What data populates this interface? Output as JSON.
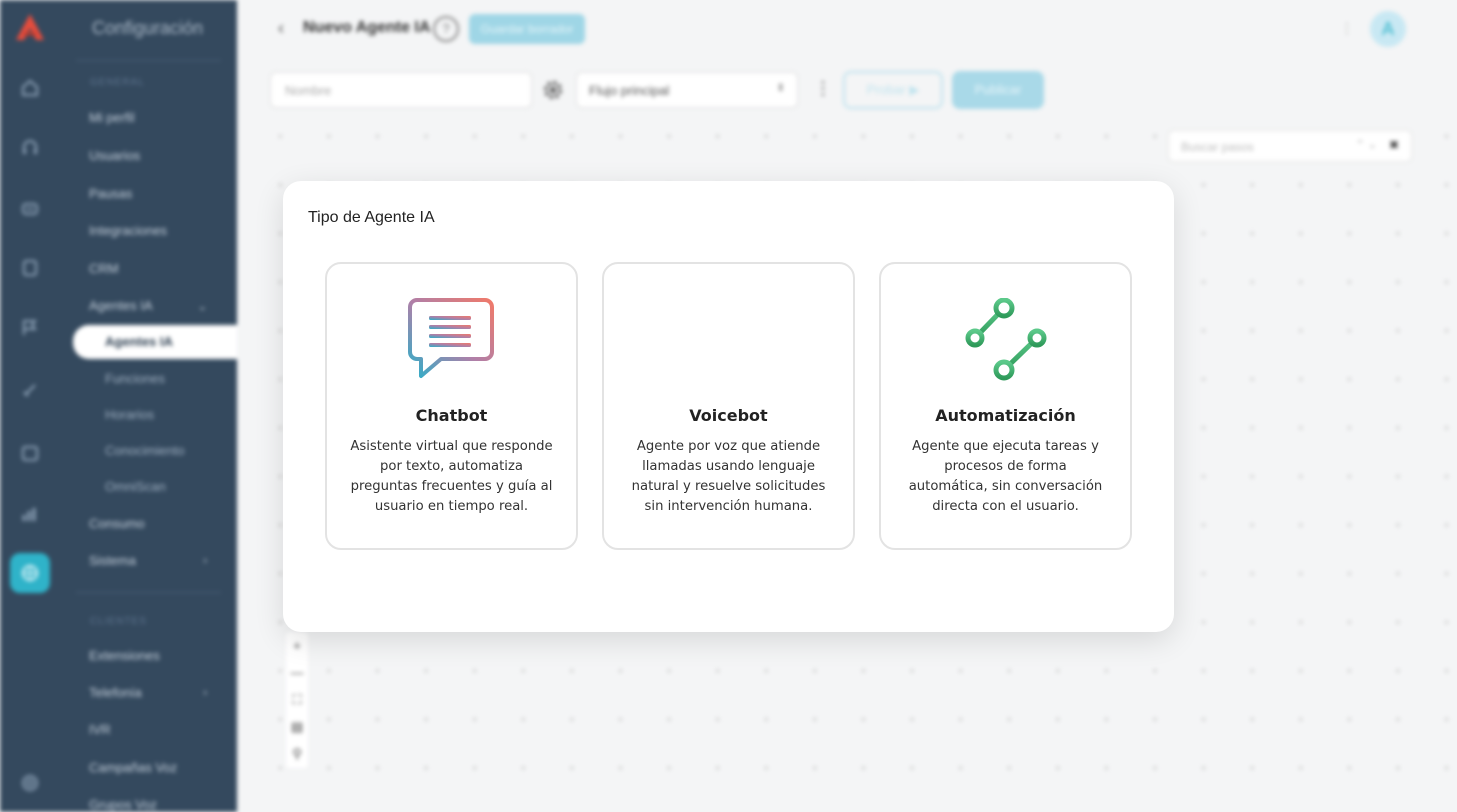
{
  "sidebar": {
    "title": "Configuración",
    "section_general": "GENERAL",
    "section_other": "CLIENTES",
    "items": [
      {
        "label": "Mi perfil"
      },
      {
        "label": "Usuarios"
      },
      {
        "label": "Pausas"
      },
      {
        "label": "Integraciones"
      },
      {
        "label": "CRM"
      },
      {
        "label": "Agentes IA"
      },
      {
        "label": "Consumo"
      },
      {
        "label": "Sistema"
      },
      {
        "label": "Extensiones"
      },
      {
        "label": "Telefonía"
      },
      {
        "label": "IVR"
      },
      {
        "label": "Campañas Voz"
      },
      {
        "label": "Grupos Voz"
      }
    ],
    "subitems": [
      {
        "label": "Agentes IA"
      },
      {
        "label": "Funciones"
      },
      {
        "label": "Horarios"
      },
      {
        "label": "Conocimiento"
      },
      {
        "label": "OmniScan"
      }
    ]
  },
  "header": {
    "title": "Nuevo Agente IA",
    "help": "?",
    "badge": "Guardar borrador",
    "avatar": "A"
  },
  "toolbar": {
    "name_placeholder": "Nombre",
    "flow_value": "Flujo principal",
    "test_label": "Probar",
    "publish_label": "Publicar"
  },
  "search_steps": {
    "placeholder": "Buscar pasos"
  },
  "modal": {
    "title": "Tipo de Agente IA",
    "cards": [
      {
        "title": "Chatbot",
        "description": "Asistente virtual que responde por texto, automatiza preguntas frecuentes y guía al usuario en tiempo real.",
        "icon": "chat-bubble-icon"
      },
      {
        "title": "Voicebot",
        "description": "Agente por voz que atiende llamadas usando lenguaje natural y resuelve solicitudes sin intervención humana.",
        "icon": "sound-wave-icon"
      },
      {
        "title": "Automatización",
        "description": "Agente que ejecuta tareas y procesos de forma automática, sin conversación directa con el usuario.",
        "icon": "workflow-nodes-icon"
      }
    ]
  },
  "colors": {
    "sidebar_bg": "#34495e",
    "accent": "#2fb3c9",
    "automation_green": "#3fae6a"
  }
}
